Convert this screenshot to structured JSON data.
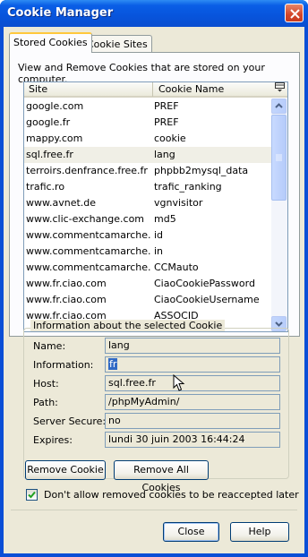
{
  "window": {
    "title": "Cookie Manager"
  },
  "tabs": [
    {
      "label": "Stored Cookies",
      "active": true
    },
    {
      "label": "Cookie Sites",
      "active": false
    }
  ],
  "description": "View and Remove Cookies that are stored on your computer.",
  "list": {
    "columns": [
      "Site",
      "Cookie Name"
    ],
    "rows": [
      {
        "site": "google.com",
        "name": "PREF"
      },
      {
        "site": "google.fr",
        "name": "PREF"
      },
      {
        "site": "mappy.com",
        "name": "cookie"
      },
      {
        "site": "sql.free.fr",
        "name": "lang"
      },
      {
        "site": "terroirs.denfrance.free.fr",
        "name": "phpbb2mysql_data"
      },
      {
        "site": "trafic.ro",
        "name": "trafic_ranking"
      },
      {
        "site": "www.avnet.de",
        "name": "vgnvisitor"
      },
      {
        "site": "www.clic-exchange.com",
        "name": "md5"
      },
      {
        "site": "www.commentcamarche.net",
        "name": "id"
      },
      {
        "site": "www.commentcamarche.net",
        "name": "in"
      },
      {
        "site": "www.commentcamarche.net",
        "name": "CCMauto"
      },
      {
        "site": "www.fr.ciao.com",
        "name": "CiaoCookiePassword"
      },
      {
        "site": "www.fr.ciao.com",
        "name": "CiaoCookieUsername"
      },
      {
        "site": "www.fr.ciao.com",
        "name": "ASSOCID"
      }
    ],
    "selected_index": 3
  },
  "details": {
    "legend": "Information about the selected Cookie",
    "fields": [
      {
        "label": "Name:",
        "value": "lang"
      },
      {
        "label": "Information:",
        "value": "fr"
      },
      {
        "label": "Host:",
        "value": "sql.free.fr"
      },
      {
        "label": "Path:",
        "value": "/phpMyAdmin/"
      },
      {
        "label": "Server Secure:",
        "value": "no"
      },
      {
        "label": "Expires:",
        "value": "lundi 30 juin 2003 16:44:24"
      }
    ]
  },
  "buttons": {
    "remove": "Remove Cookie",
    "remove_all": "Remove All Cookies",
    "close": "Close",
    "help": "Help"
  },
  "checkbox": {
    "label": "Don't allow removed cookies to be reaccepted later",
    "checked": true
  },
  "colors": {
    "titlebar": "#0a5ee6",
    "selection": "#316ac5",
    "panel": "#ece9d8"
  }
}
